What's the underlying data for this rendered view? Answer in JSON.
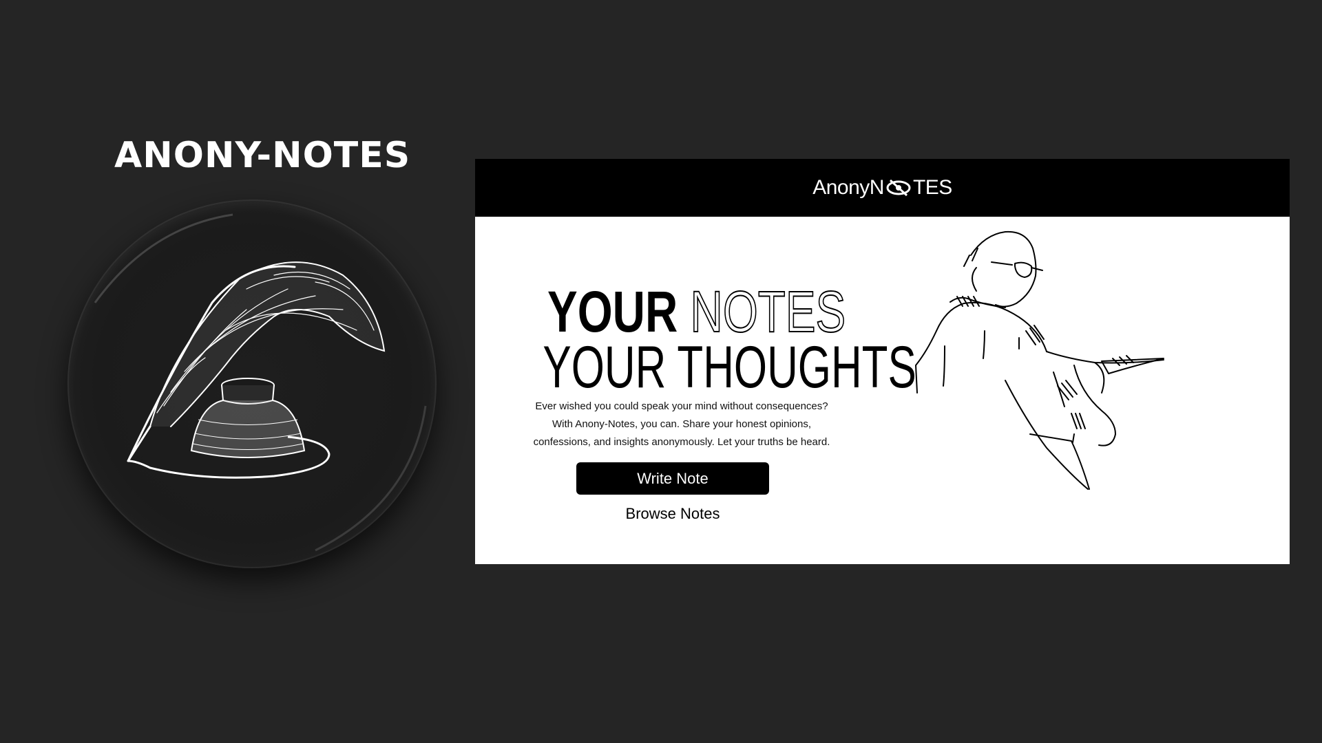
{
  "brand": {
    "title": "ANONY-NOTES"
  },
  "badge": {
    "illustration": "quill-and-inkwell-icon"
  },
  "preview": {
    "logo_prefix": "AnonyN",
    "logo_icon": "eye-slash-icon",
    "logo_suffix": "TES",
    "headline_word1": "YOUR",
    "headline_word2": "NOTES",
    "headline_line2": "YOUR THOUGHTS",
    "description": "Ever wished you could speak your mind without consequences? With Anony-Notes, you can. Share your honest opinions, confessions, and insights anonymously. Let your truths be heard.",
    "write_button": "Write Note",
    "browse_link": "Browse Notes",
    "illustration": "writer-sketch"
  },
  "colors": {
    "background": "#252525",
    "header": "#000000",
    "content": "#ffffff",
    "button": "#000000"
  }
}
